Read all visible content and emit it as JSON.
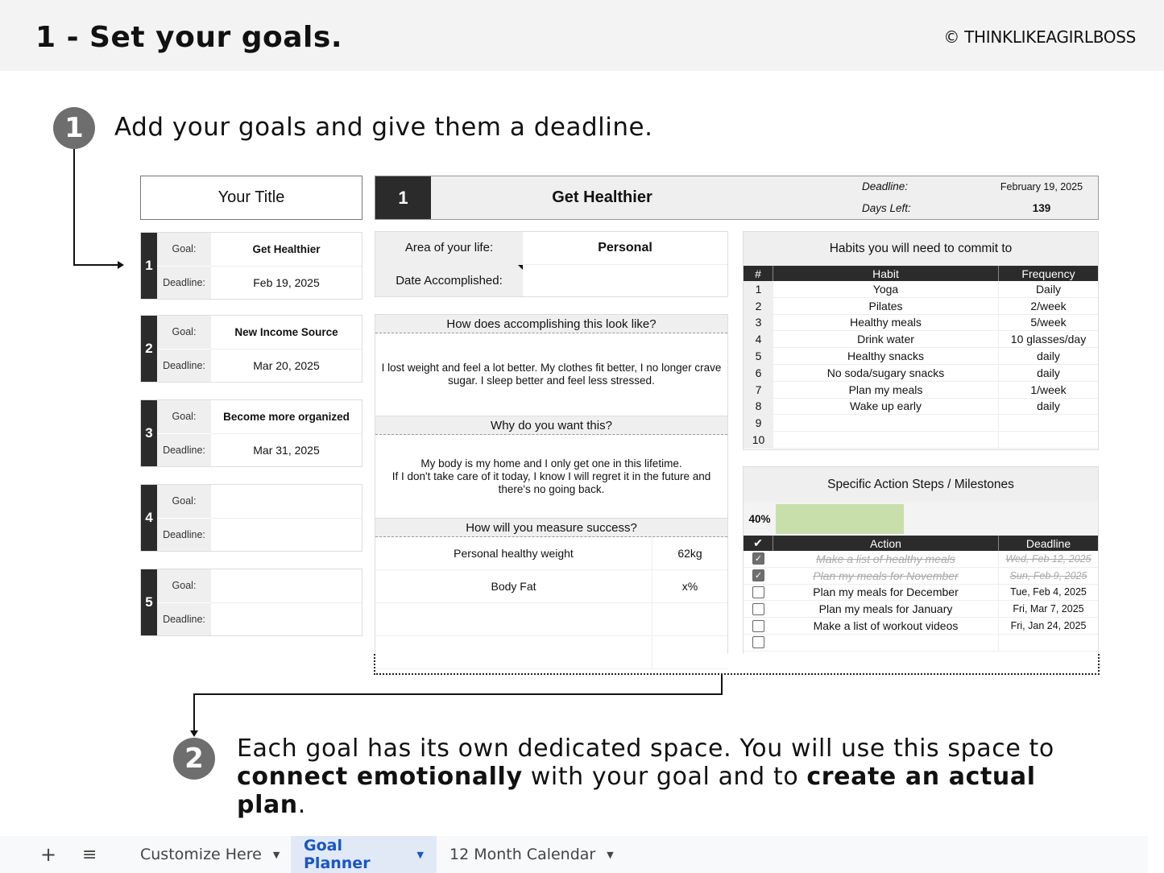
{
  "header": {
    "title": "1 - Set your goals.",
    "copyright": "© THINKLIKEAGIRLBOSS"
  },
  "steps": {
    "step1": {
      "number": "1",
      "text": "Add your goals and give them a deadline."
    },
    "step2": {
      "number": "2",
      "text_1": "Each goal has its own dedicated space. You will use this space to ",
      "bold_1": "connect emotionally",
      "text_2": " with your goal and to ",
      "bold_2": "create an actual plan",
      "text_3": "."
    }
  },
  "goals_list": {
    "title": "Your Title",
    "goal_label": "Goal:",
    "deadline_label": "Deadline:",
    "items": [
      {
        "number": "1",
        "goal": "Get Healthier",
        "deadline": "Feb 19, 2025"
      },
      {
        "number": "2",
        "goal": "New Income Source",
        "deadline": "Mar 20, 2025"
      },
      {
        "number": "3",
        "goal": "Become more organized",
        "deadline": "Mar 31, 2025"
      },
      {
        "number": "4",
        "goal": "",
        "deadline": ""
      },
      {
        "number": "5",
        "goal": "",
        "deadline": ""
      }
    ]
  },
  "goal_detail": {
    "number": "1",
    "title": "Get Healthier",
    "deadline_label": "Deadline:",
    "deadline_value": "February 19, 2025",
    "days_left_label": "Days Left:",
    "days_left_value": "139",
    "area_label": "Area of your life:",
    "area_value": "Personal",
    "date_accomplished_label": "Date Accomplished:",
    "date_accomplished_value": "",
    "q1_heading": "How does accomplishing this look like?",
    "q1_answer": "I lost weight and feel a lot better. My clothes fit better, I no longer crave sugar. I sleep better and feel less stressed.",
    "q2_heading": "Why do you want this?",
    "q2_answer_line1": "My body is my home and I only get one in this lifetime.",
    "q2_answer_line2": "If I don't take care of it today, I know I will regret it in the future and there's no going back.",
    "q3_heading": "How will you measure success?",
    "measures": [
      {
        "metric": "Personal healthy weight",
        "target": "62kg"
      },
      {
        "metric": "Body Fat",
        "target": "x%"
      },
      {
        "metric": "",
        "target": ""
      },
      {
        "metric": "",
        "target": ""
      }
    ]
  },
  "habits": {
    "title": "Habits you will need to commit to",
    "columns": [
      "#",
      "Habit",
      "Frequency"
    ],
    "rows": [
      {
        "num": "1",
        "habit": "Yoga",
        "frequency": "Daily"
      },
      {
        "num": "2",
        "habit": "Pilates",
        "frequency": "2/week"
      },
      {
        "num": "3",
        "habit": "Healthy meals",
        "frequency": "5/week"
      },
      {
        "num": "4",
        "habit": "Drink water",
        "frequency": "10 glasses/day"
      },
      {
        "num": "5",
        "habit": "Healthy snacks",
        "frequency": "daily"
      },
      {
        "num": "6",
        "habit": "No soda/sugary snacks",
        "frequency": "daily"
      },
      {
        "num": "7",
        "habit": "Plan my meals",
        "frequency": "1/week"
      },
      {
        "num": "8",
        "habit": "Wake up early",
        "frequency": "daily"
      },
      {
        "num": "9",
        "habit": "",
        "frequency": ""
      },
      {
        "num": "10",
        "habit": "",
        "frequency": ""
      }
    ]
  },
  "actions": {
    "title": "Specific Action Steps / Milestones",
    "progress_label": "40%",
    "progress_percent": 40,
    "progress_color": "#c8dfac",
    "columns": [
      "✔",
      "Action",
      "Deadline"
    ],
    "rows": [
      {
        "done": true,
        "action": "Make a list of healthy meals",
        "deadline": "Wed, Feb 12, 2025"
      },
      {
        "done": true,
        "action": "Plan my meals for November",
        "deadline": "Sun, Feb 9, 2025"
      },
      {
        "done": false,
        "action": "Plan my meals for December",
        "deadline": "Tue, Feb 4, 2025"
      },
      {
        "done": false,
        "action": "Plan my meals for January",
        "deadline": "Fri, Mar 7, 2025"
      },
      {
        "done": false,
        "action": "Make a list of workout videos",
        "deadline": "Fri, Jan 24, 2025"
      },
      {
        "done": false,
        "action": "",
        "deadline": ""
      }
    ]
  },
  "tabbar": {
    "add_icon": "+",
    "menu_icon": "≡",
    "tabs": [
      {
        "label": "Customize Here",
        "active": false
      },
      {
        "label": "Goal Planner",
        "active": true
      },
      {
        "label": "12 Month Calendar",
        "active": false
      }
    ]
  }
}
